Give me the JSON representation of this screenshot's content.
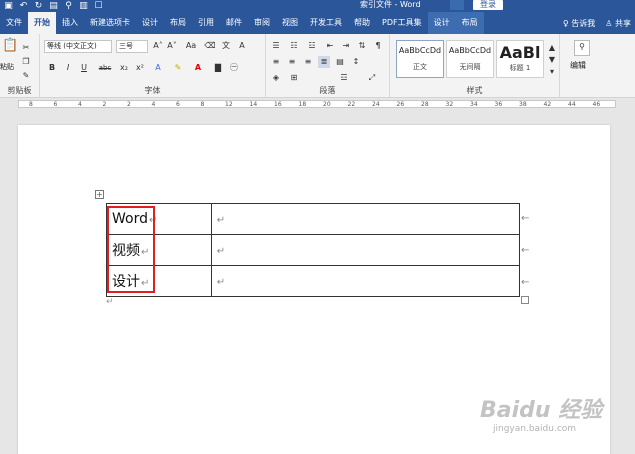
{
  "titlebar": {
    "title": "索引文件 - Word",
    "login": "登录",
    "qat": [
      "保存",
      "撤销",
      "重做"
    ]
  },
  "tabs": [
    "文件",
    "开始",
    "插入",
    "新建选项卡",
    "设计",
    "布局",
    "引用",
    "邮件",
    "审阅",
    "视图",
    "开发工具",
    "帮助",
    "PDF工具集",
    "设计",
    "布局"
  ],
  "tabs_right": {
    "tell": "告诉我",
    "share": "共享"
  },
  "ribbon": {
    "clipboard_label": "剪贴板",
    "paste_label": "粘贴",
    "font_name": "等线 (中文正文)",
    "font_size": "三号",
    "font_label": "字体",
    "paragraph_label": "段落",
    "styles_label": "样式",
    "editing_label": "编辑",
    "styles": [
      {
        "sample": "AaBbCcDd",
        "name": "正文"
      },
      {
        "sample": "AaBbCcDd",
        "name": "无间隔"
      },
      {
        "sample": "AaBl",
        "name": "标题 1"
      }
    ],
    "buttons": {
      "bold": "B",
      "italic": "I",
      "underline": "U",
      "strike": "abc",
      "sub": "x₂",
      "sup": "x²",
      "grow": "A˄",
      "shrink": "A˅",
      "clear": "Aa"
    }
  },
  "ruler": [
    "8",
    "6",
    "4",
    "2",
    "2",
    "4",
    "6",
    "8",
    "12",
    "14",
    "16",
    "18",
    "20",
    "22",
    "24",
    "26",
    "28",
    "32",
    "34",
    "36",
    "38",
    "42",
    "44",
    "46"
  ],
  "table": {
    "rows": [
      [
        "Word",
        ""
      ],
      [
        "视频",
        ""
      ],
      [
        "设计",
        ""
      ]
    ],
    "cell_mark": "↵",
    "row_mark": "←"
  },
  "watermark": {
    "logo": "Baidu 经验",
    "url": "jingyan.baidu.com"
  },
  "colors": {
    "accent": "#2b579a",
    "highlight": "#e02020",
    "ribbon_bg": "#f3f3f3"
  }
}
